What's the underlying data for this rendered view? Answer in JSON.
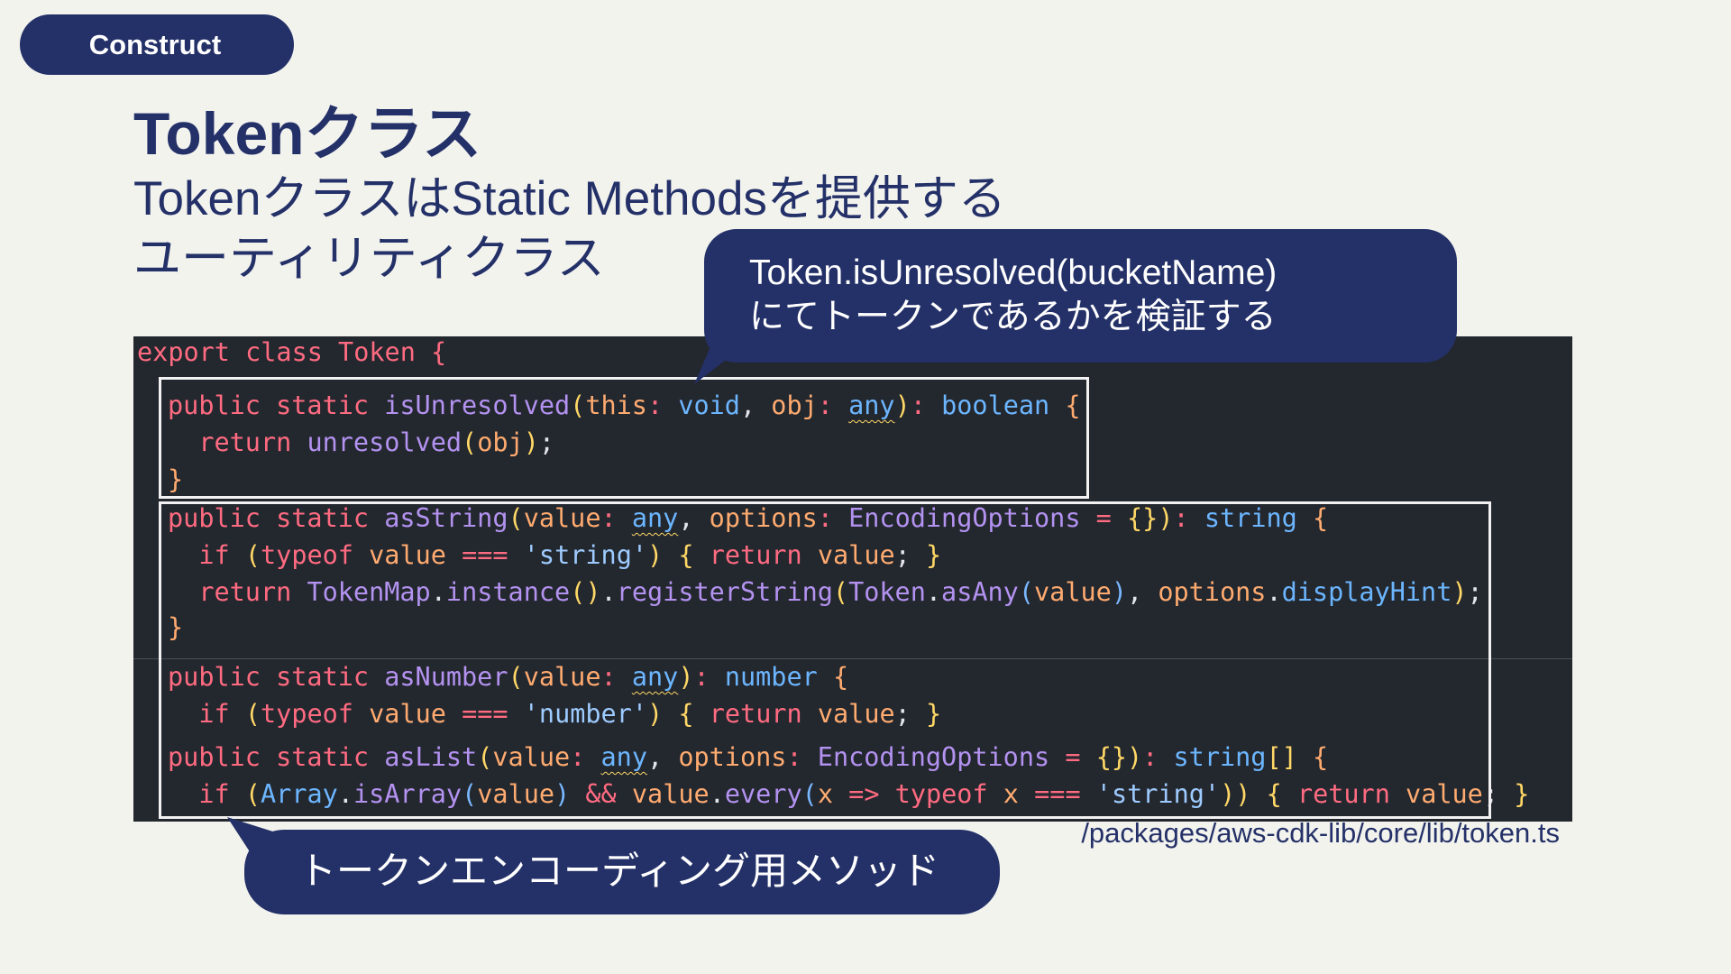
{
  "tag": {
    "label": "Construct"
  },
  "title": "Tokenクラス",
  "subtitle": {
    "line1": "TokenクラスはStatic Methodsを提供する",
    "line2": "ユーティリティクラス"
  },
  "callout_top": {
    "line1": "Token.isUnresolved(bucketName)",
    "line2": "にてトークンであるかを検証する"
  },
  "callout_bottom": {
    "label": "トークンエンコーディング用メソッド"
  },
  "file_path": "/packages/aws-cdk-lib/core/lib/token.ts",
  "code": {
    "language": "TypeScript",
    "lines": [
      "export class Token {",
      "public static isUnresolved(this: void, obj: any): boolean {",
      "  return unresolved(obj);",
      "}",
      "public static asString(value: any, options: EncodingOptions = {}): string {",
      "  if (typeof value === 'string') { return value; }",
      "  return TokenMap.instance().registerString(Token.asAny(value), options.displayHint);",
      "}",
      "public static asNumber(value: any): number {",
      "  if (typeof value === 'number') { return value; }",
      "public static asList(value: any, options: EncodingOptions = {}): string[] {",
      "  if (Array.isArray(value) && value.every(x => typeof x === 'string')) { return value; }"
    ]
  },
  "colors": {
    "navy": "#243168",
    "background": "#f3f3ee",
    "code_background": "#23272e",
    "keyword": "#ff6b81"
  }
}
